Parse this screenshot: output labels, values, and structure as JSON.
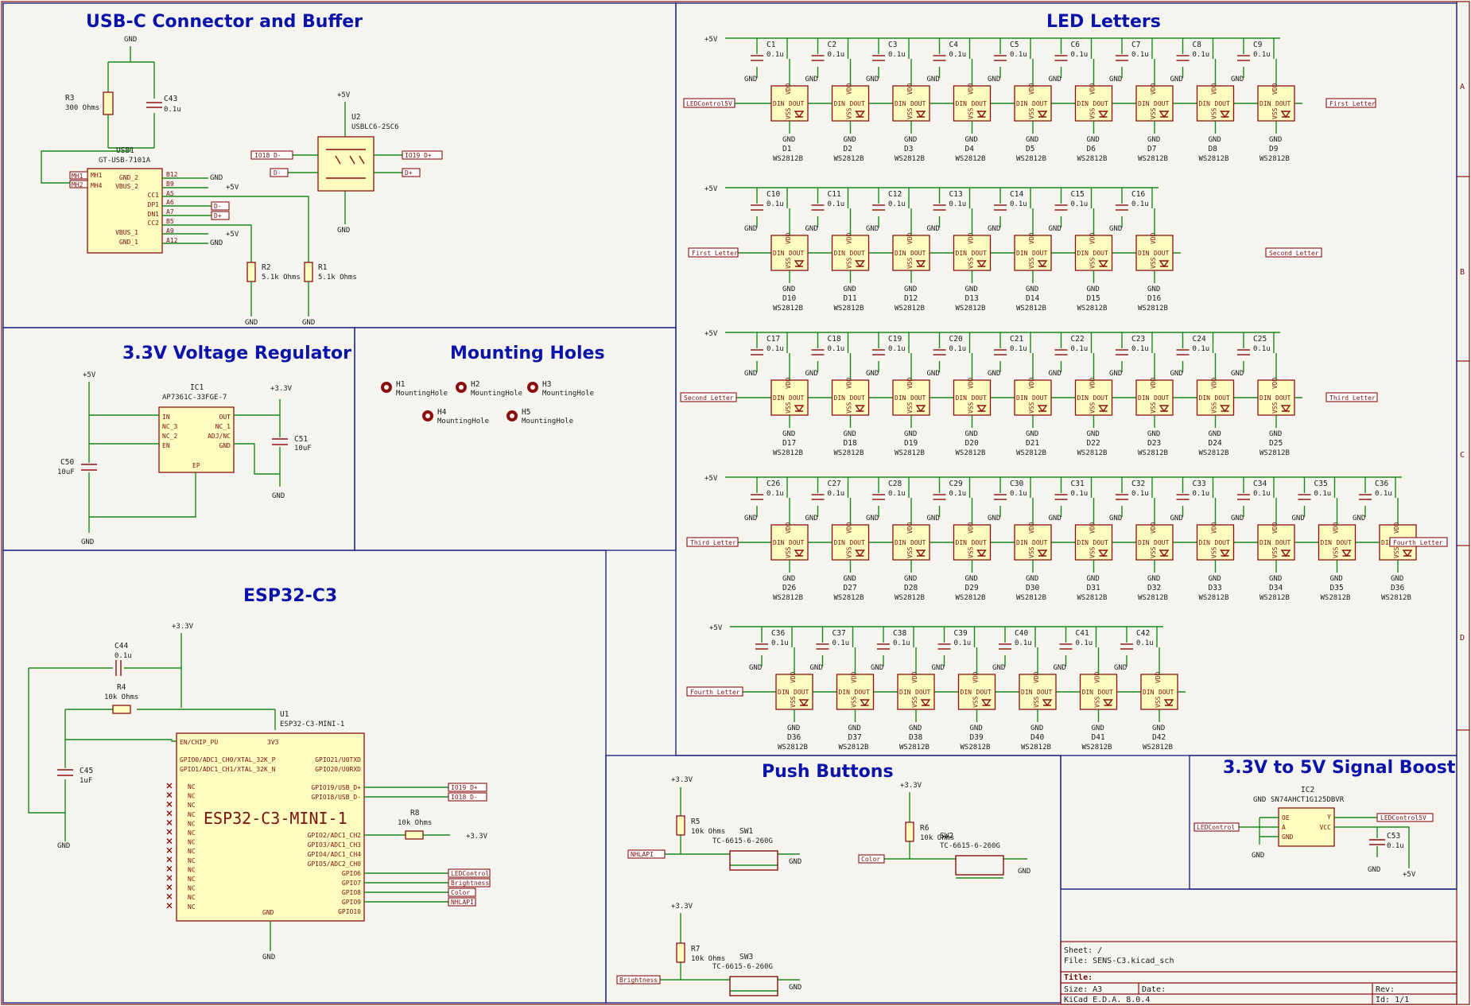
{
  "sections": {
    "usb": "USB-C Connector and Buffer",
    "led": "LED Letters",
    "reg": "3.3V Voltage Regulator",
    "mount": "Mounting Holes",
    "esp": "ESP32-C3",
    "buttons": "Push Buttons",
    "boost": "3.3V to 5V Signal Boost"
  },
  "usb": {
    "r3_ref": "R3",
    "r3_val": "300 Ohms",
    "c43_ref": "C43",
    "c43_val": "0.1u",
    "usb_ref": "USB1",
    "usb_val": "GT-USB-7101A",
    "u2_ref": "U2",
    "u2_val": "USBLC6-2SC6",
    "r2_ref": "R2",
    "r2_val": "5.1k Ohms",
    "r1_ref": "R1",
    "r1_val": "5.1k Ohms",
    "pins_left": [
      "MH1",
      "MH4"
    ],
    "pins_right": [
      "GND_2",
      "VBUS_2",
      "CC1",
      "DP1",
      "DN1",
      "CC2",
      "VBUS_1",
      "GND_1"
    ],
    "pin_nums": [
      "B12",
      "B9",
      "A5",
      "A6",
      "A7",
      "B5",
      "A9",
      "A12"
    ],
    "mh_tags": [
      "MH1",
      "MH2"
    ],
    "net_dminus": "D-",
    "net_dplus": "D+",
    "net_io18": "IO18_D-",
    "net_io19": "IO19_D+",
    "gnd": "GND",
    "p5v": "+5V"
  },
  "led": {
    "ctrl_in": "LEDControl5V",
    "nets": [
      "First Letter",
      "Second Letter",
      "Third Letter",
      "Fourth Letter"
    ],
    "rows": [
      {
        "start": 1,
        "count": 9,
        "cstart": 1
      },
      {
        "start": 10,
        "count": 7,
        "cstart": 10
      },
      {
        "start": 17,
        "count": 9,
        "cstart": 17
      },
      {
        "start": 26,
        "count": 11,
        "cstart": 26
      },
      {
        "start": 36,
        "count": 7,
        "cstart": 36
      }
    ],
    "part": "WS2812B",
    "cap_val": "0.1u",
    "pin_vdd": "VDD",
    "pin_vss": "VSS",
    "pin_din": "DIN",
    "pin_dout": "DOUT",
    "p5v": "+5V",
    "gnd": "GND"
  },
  "reg": {
    "ic_ref": "IC1",
    "ic_val": "AP7361C-33FGE-7",
    "pins_left": [
      "IN",
      "NC_3",
      "NC_2",
      "EN"
    ],
    "pins_right": [
      "OUT",
      "NC_1",
      "ADJ/NC",
      "GND"
    ],
    "pin_ep": "EP",
    "c50_ref": "C50",
    "c50_val": "10uF",
    "c51_ref": "C51",
    "c51_val": "10uF",
    "p5v": "+5V",
    "p33": "+3.3V",
    "gnd": "GND"
  },
  "mount": {
    "holes": [
      {
        "ref": "H1",
        "val": "MountingHole"
      },
      {
        "ref": "H2",
        "val": "MountingHole"
      },
      {
        "ref": "H3",
        "val": "MountingHole"
      },
      {
        "ref": "H4",
        "val": "MountingHole"
      },
      {
        "ref": "H5",
        "val": "MountingHole"
      }
    ]
  },
  "esp": {
    "u_ref": "U1",
    "u_val": "ESP32-C3-MINI-1",
    "body": "ESP32-C3-MINI-1",
    "c44_ref": "C44",
    "c44_val": "0.1u",
    "r4_ref": "R4",
    "r4_val": "10k Ohms",
    "c45_ref": "C45",
    "c45_val": "1uF",
    "r8_ref": "R8",
    "r8_val": "10k Ohms",
    "pin_en": "EN/CHIP_PU",
    "pin_3v3": "3V3",
    "pins_left": [
      "GPIO0/ADC1_CH0/XTAL_32K_P",
      "GPIO1/ADC1_CH1/XTAL_32K_N"
    ],
    "pins_right": [
      "GPIO21/U0TXD",
      "GPIO20/U0RXD",
      "GPIO19/USB_D+",
      "GPIO18/USB_D-",
      "GPIO2/ADC1_CH2",
      "GPIO3/ADC1_CH3",
      "GPIO4/ADC1_CH4",
      "GPIO5/ADC2_CH0",
      "GPIO6",
      "GPIO7",
      "GPIO8",
      "GPIO9",
      "GPIO10"
    ],
    "nc": "NC",
    "pin_gnd": "GND",
    "nets": [
      "IO19_D+",
      "IO18_D-",
      "LEDControl",
      "Brightness",
      "Color",
      "NHLAPI"
    ],
    "p33": "+3.3V",
    "gnd": "GND"
  },
  "buttons": {
    "r5_ref": "R5",
    "r5_val": "10k Ohms",
    "sw1_ref": "SW1",
    "sw1_val": "TC-6615-6-260G",
    "net1": "NHLAPI",
    "r6_ref": "R6",
    "r6_val": "10k Ohms",
    "sw2_ref": "SW2",
    "sw2_val": "TC-6615-6-260G",
    "net2": "Color",
    "r7_ref": "R7",
    "r7_val": "10k Ohms",
    "sw3_ref": "SW3",
    "sw3_val": "TC-6615-6-260G",
    "net3": "Brightness",
    "p33": "+3.3V",
    "gnd": "GND"
  },
  "boost": {
    "ic_ref": "IC2",
    "ic_val": "SN74AHCT1G125DBVR",
    "ic_gnd": "GND",
    "pins_left": [
      "OE",
      "A",
      "GND"
    ],
    "pins_right": [
      "Y",
      "VCC"
    ],
    "net_in": "LEDControl",
    "net_out": "LEDControl5V",
    "c53_ref": "C53",
    "c53_val": "0.1u",
    "p5v": "+5V",
    "gnd": "GND"
  },
  "titleblock": {
    "sheet": "Sheet: /",
    "file": "File: SENS-C3.kicad_sch",
    "title": "Title:",
    "size": "Size: A3",
    "date": "Date:",
    "rev": "Rev:",
    "tool": "KiCad E.D.A. 8.0.4",
    "id": "Id: 1/1"
  },
  "frame": {
    "rows": [
      "A",
      "B",
      "C",
      "D"
    ]
  }
}
